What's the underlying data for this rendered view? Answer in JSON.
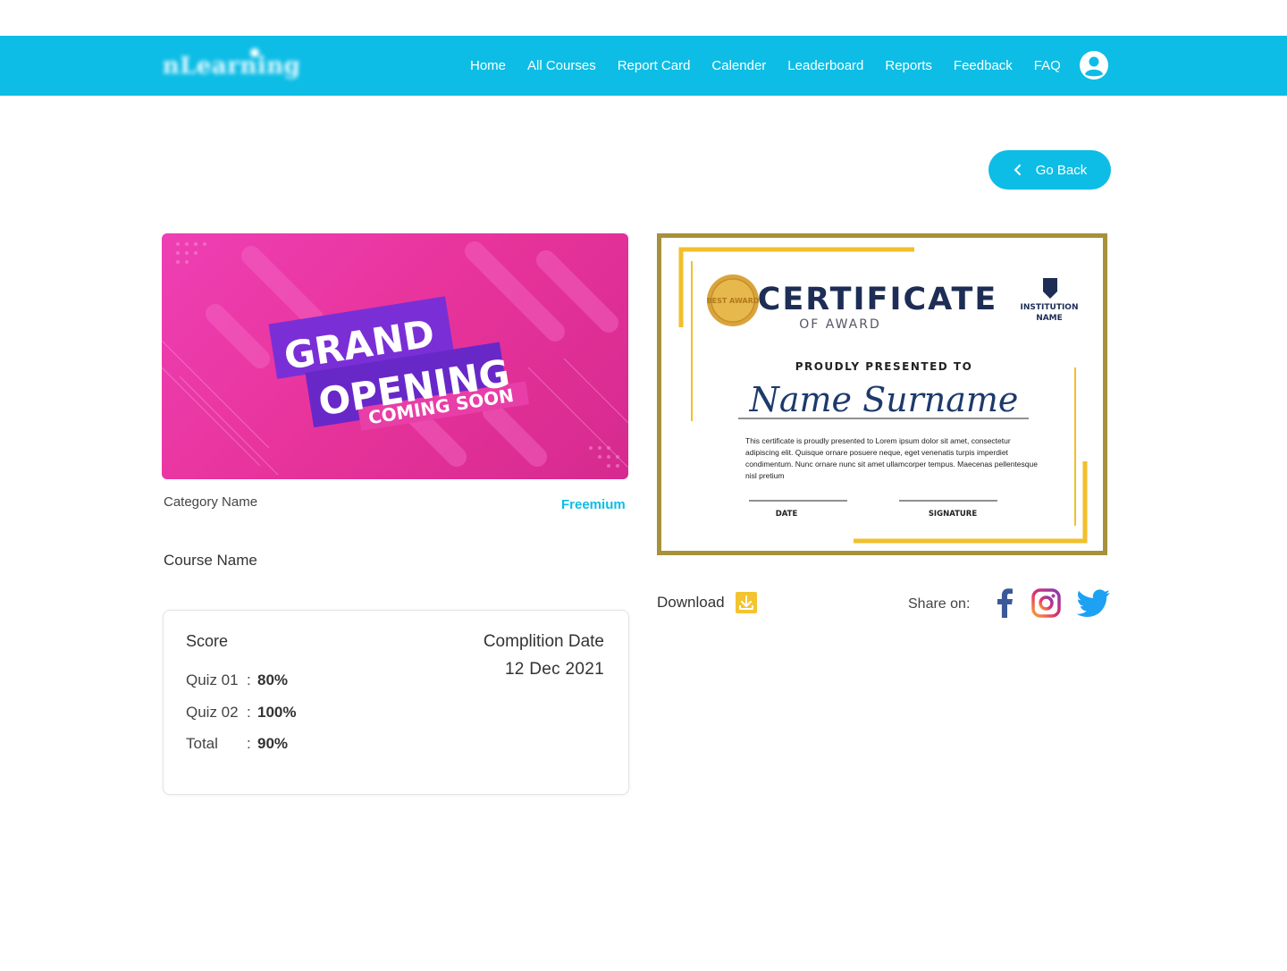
{
  "header": {
    "logo_text": "nLearning",
    "nav": [
      "Home",
      "All Courses",
      "Report Card",
      "Calender",
      "Leaderboard",
      "Reports",
      "Feedback",
      "FAQ"
    ],
    "user_icon": "user-circle-icon",
    "brand_color": "#0dbde5"
  },
  "go_back": {
    "label": "Go Back",
    "icon": "chevron-left-icon"
  },
  "course": {
    "banner": {
      "line1": "GRAND",
      "line2": "OPENING",
      "line3": "COMING SOON"
    },
    "category": "Category Name",
    "plan": "Freemium",
    "name": "Course Name"
  },
  "score": {
    "title": "Score",
    "rows": [
      {
        "label": "Quiz 01",
        "sep": ":",
        "value": "80%"
      },
      {
        "label": "Quiz 02",
        "sep": ":",
        "value": "100%"
      },
      {
        "label": "Total",
        "sep": ":",
        "value": "90%"
      }
    ],
    "completion_label": "Complition Date",
    "completion_date": "12 Dec 2021"
  },
  "certificate": {
    "seal_text": "BEST AWARD",
    "title": "CERTIFICATE",
    "subtitle": "OF AWARD",
    "institution_line1": "INSTITUTION",
    "institution_line2": "NAME",
    "presented": "PROUDLY  PRESENTED  TO",
    "recipient": "Name  Surname",
    "body": [
      "This certificate is proudly presented to Lorem ipsum dolor sit amet, consectetur",
      "adipiscing elit. Quisque ornare posuere neque, eget venenatis turpis imperdiet",
      "condimentum. Nunc ornare nunc sit amet ullamcorper tempus. Maecenas pellentesque",
      "nisl pretium"
    ],
    "date_label": "DATE",
    "signature_label": "SIGNATURE"
  },
  "actions": {
    "download_label": "Download",
    "download_icon": "download-icon",
    "share_label": "Share on:",
    "share_icons": [
      "facebook-icon",
      "instagram-icon",
      "twitter-icon"
    ]
  }
}
